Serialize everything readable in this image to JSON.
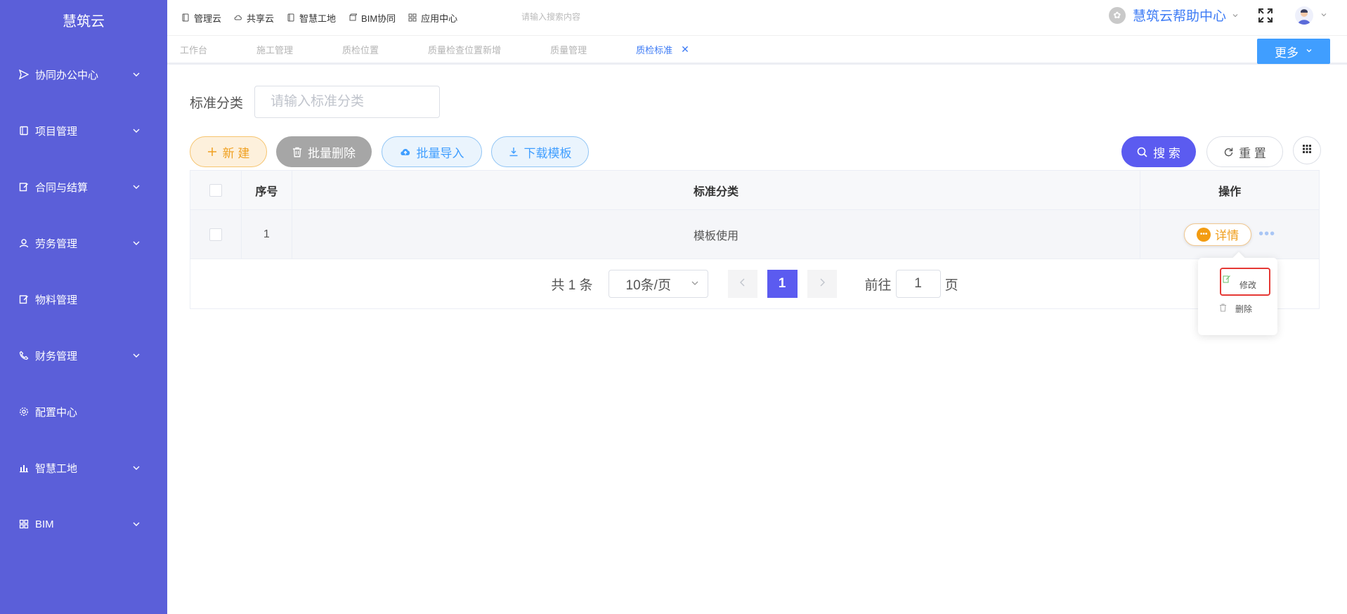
{
  "brand": "慧筑云",
  "sidebar": {
    "items": [
      {
        "label": "协同办公中心",
        "icon": "send-icon",
        "has_children": true
      },
      {
        "label": "项目管理",
        "icon": "book-icon",
        "has_children": true
      },
      {
        "label": "合同与结算",
        "icon": "edit-doc-icon",
        "has_children": true
      },
      {
        "label": "劳务管理",
        "icon": "user-icon",
        "has_children": true
      },
      {
        "label": "物料管理",
        "icon": "edit-doc-icon",
        "has_children": false
      },
      {
        "label": "财务管理",
        "icon": "phone-icon",
        "has_children": true
      },
      {
        "label": "配置中心",
        "icon": "gear-icon",
        "has_children": false
      },
      {
        "label": "智慧工地",
        "icon": "bar-chart-icon",
        "has_children": true
      },
      {
        "label": "BIM",
        "icon": "grid-icon",
        "has_children": true
      }
    ]
  },
  "topnav": {
    "items": [
      {
        "label": "管理云",
        "icon": "doc-icon"
      },
      {
        "label": "共享云",
        "icon": "cloud-icon"
      },
      {
        "label": "智慧工地",
        "icon": "book-icon"
      },
      {
        "label": "BIM协同",
        "icon": "cube-icon"
      },
      {
        "label": "应用中心",
        "icon": "grid-icon"
      }
    ],
    "search_placeholder": "请输入搜索内容",
    "help_label": "慧筑云帮助中心"
  },
  "tabs": [
    {
      "label": "工作台",
      "active": false
    },
    {
      "label": "施工管理",
      "active": false
    },
    {
      "label": "质检位置",
      "active": false
    },
    {
      "label": "质量检查位置新增",
      "active": false
    },
    {
      "label": "质量管理",
      "active": false
    },
    {
      "label": "质检标准",
      "active": true
    }
  ],
  "more_label": "更多",
  "filter": {
    "label": "标准分类",
    "placeholder": "请输入标准分类"
  },
  "toolbar": {
    "new_label": "新 建",
    "batch_delete_label": "批量删除",
    "batch_import_label": "批量导入",
    "download_template_label": "下载模板",
    "search_label": "搜 索",
    "reset_label": "重 置"
  },
  "table": {
    "headers": {
      "no": "序号",
      "category": "标准分类",
      "operation": "操作"
    },
    "rows": [
      {
        "no": "1",
        "category": "模板使用",
        "detail_label": "详情"
      }
    ]
  },
  "pagination": {
    "total_text": "共 1 条",
    "page_size": "10条/页",
    "current_page": "1",
    "goto_prefix": "前往",
    "goto_value": "1",
    "goto_suffix": "页"
  },
  "row_menu": {
    "edit_label": "修改",
    "delete_label": "删除"
  },
  "colors": {
    "sidebar_bg": "#5b5fd9",
    "primary": "#5b5bf0",
    "link_blue": "#409eff",
    "warning": "#f0a020",
    "highlight_border": "#e53935"
  }
}
